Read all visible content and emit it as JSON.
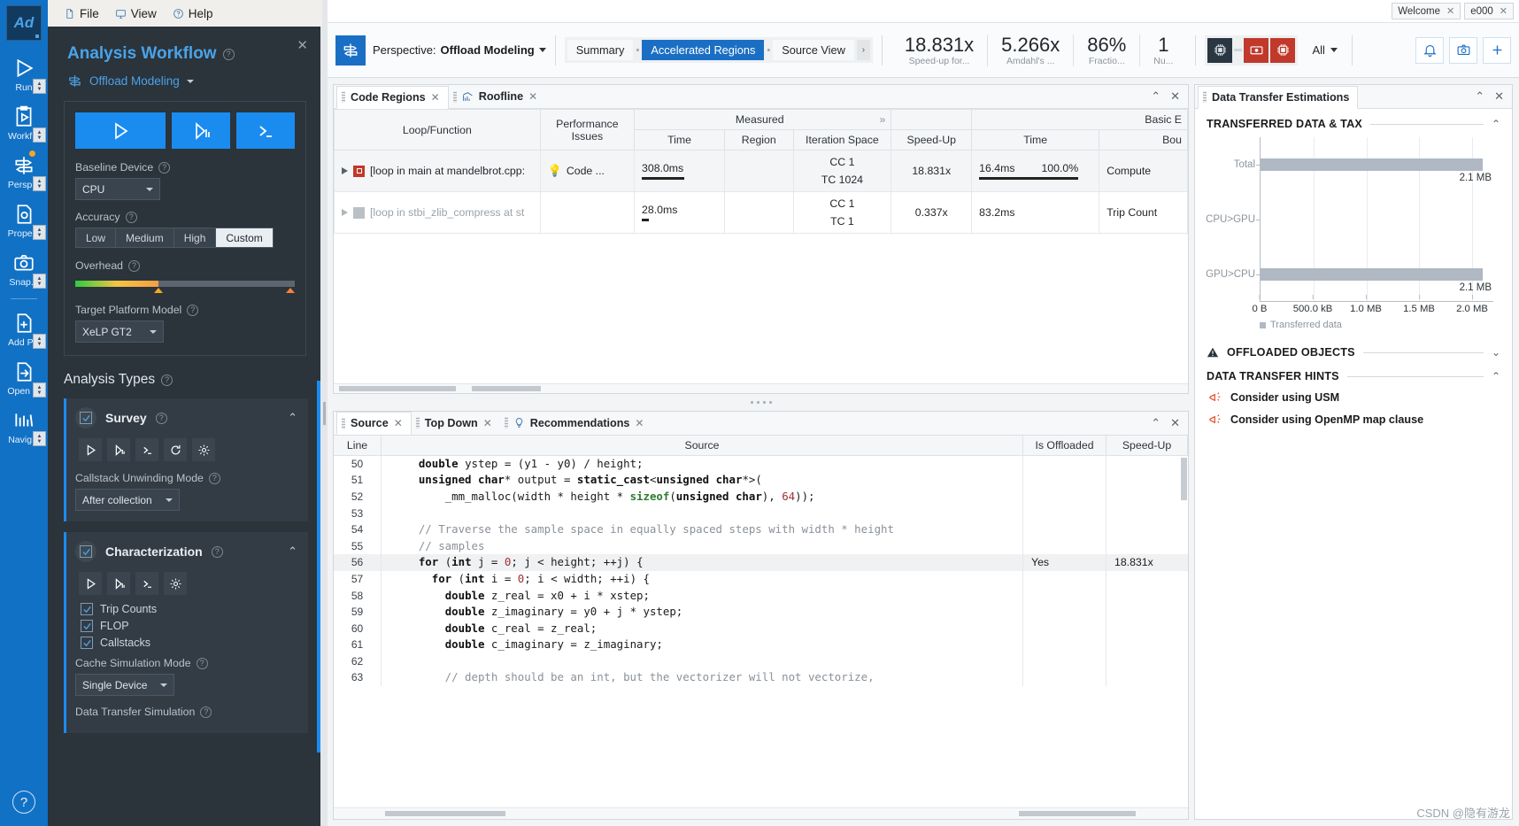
{
  "rail": {
    "logo": "Ad",
    "items": [
      {
        "label": "Run",
        "icon": "play-icon"
      },
      {
        "label": "Workf...",
        "icon": "workflow-icon"
      },
      {
        "label": "Persp...",
        "icon": "perspective-icon"
      },
      {
        "label": "Prope...",
        "icon": "properties-gear-icon"
      },
      {
        "label": "Snap...",
        "icon": "snapshot-camera-icon"
      },
      {
        "label": "Add P...",
        "icon": "add-project-icon"
      },
      {
        "label": "Open ...",
        "icon": "open-result-icon"
      },
      {
        "label": "Navig...",
        "icon": "navigation-chart-icon"
      }
    ],
    "help": "?"
  },
  "menubar": {
    "items": [
      {
        "label": "File",
        "icon": "file-icon"
      },
      {
        "label": "View",
        "icon": "monitor-icon"
      },
      {
        "label": "Help",
        "icon": "help-circle-icon"
      }
    ]
  },
  "titlebar": {
    "tabs": [
      {
        "label": "Welcome",
        "close": "✕"
      },
      {
        "label": "e000",
        "close": "✕"
      }
    ]
  },
  "workflow": {
    "title": "Analysis Workflow",
    "close": "✕",
    "subtitle": "Offload Modeling",
    "baseline_label": "Baseline Device",
    "baseline_value": "CPU",
    "accuracy_label": "Accuracy",
    "accuracy_options": [
      "Low",
      "Medium",
      "High",
      "Custom"
    ],
    "accuracy_selected": "Custom",
    "overhead_label": "Overhead",
    "target_label": "Target Platform Model",
    "target_value": "XeLP GT2",
    "analysis_types_label": "Analysis Types",
    "cards": [
      {
        "title": "Survey",
        "checked": true,
        "sub_label": "Callstack Unwinding Mode",
        "sub_value": "After collection",
        "buttons": [
          "run-icon",
          "run-step-icon",
          "command-line-icon",
          "refresh-icon",
          "gear-icon"
        ],
        "checkboxes": []
      },
      {
        "title": "Characterization",
        "checked": true,
        "sub_label": "Cache Simulation Mode",
        "sub_value": "Single Device",
        "buttons": [
          "run-icon",
          "run-step-icon",
          "command-line-icon",
          "gear-icon"
        ],
        "checkboxes": [
          {
            "label": "Trip Counts",
            "checked": true
          },
          {
            "label": "FLOP",
            "checked": true
          },
          {
            "label": "Callstacks",
            "checked": true
          }
        ],
        "footer_label": "Data Transfer Simulation"
      }
    ]
  },
  "toolbar": {
    "perspective_prefix": "Perspective:",
    "perspective_value": "Offload Modeling",
    "view_tabs": [
      {
        "label": "Summary",
        "active": false
      },
      {
        "label": "Accelerated Regions",
        "active": true
      },
      {
        "label": "Source View",
        "active": false
      }
    ],
    "more_tabs": "›",
    "metrics": [
      {
        "value": "18.831x",
        "caption": "Speed-up for..."
      },
      {
        "value": "5.266x",
        "caption": "Amdahl's ..."
      },
      {
        "value": "86%",
        "caption": "Fractio..."
      },
      {
        "value": "1",
        "caption": "Nu..."
      }
    ],
    "device_filter": "All",
    "devices": [
      "cpu-chip-icon",
      "gpu-icon",
      "gpu-chip-icon"
    ],
    "right_tools": [
      "bell-icon",
      "camera-icon",
      "plus-icon"
    ]
  },
  "code_regions": {
    "tabs": [
      {
        "label": "Code Regions",
        "active": true,
        "icon": null
      },
      {
        "label": "Roofline",
        "active": false,
        "icon": "roofline-icon"
      }
    ],
    "panel_controls": [
      "collapse-icon",
      "close-icon"
    ],
    "group_headers": [
      {
        "label": "Measured",
        "expand": "»"
      },
      {
        "label": "Basic E"
      }
    ],
    "columns": [
      "Loop/Function",
      "Performance Issues",
      "Time",
      "Region",
      "Iteration Space",
      "Speed-Up",
      "Time",
      "Bou"
    ],
    "rows": [
      {
        "name": "[loop in main at mandelbrot.cpp:",
        "marker": "red",
        "issue": "Code ...",
        "time": "308.0ms",
        "time_bar": 72,
        "region": "",
        "iteration_space": [
          "CC 1",
          "TC 1024"
        ],
        "speedup": "18.831x",
        "basic_time": "16.4ms",
        "basic_pct": "100.0%",
        "bounded_by": "Compute",
        "selected": true
      },
      {
        "name": "[loop in stbi_zlib_compress at st",
        "marker": "gray",
        "issue": "",
        "time": "28.0ms",
        "time_bar": 9,
        "region": "",
        "iteration_space": [
          "CC 1",
          "TC 1"
        ],
        "speedup": "0.337x",
        "basic_time": "83.2ms",
        "basic_pct": "",
        "bounded_by": "Trip Count",
        "selected": false
      }
    ]
  },
  "source_panel": {
    "tabs": [
      {
        "label": "Source",
        "active": true,
        "icon": null
      },
      {
        "label": "Top Down",
        "active": false,
        "icon": null
      },
      {
        "label": "Recommendations",
        "active": false,
        "icon": "bulb-icon"
      }
    ],
    "columns": [
      "Line",
      "Source",
      "Is Offloaded",
      "Speed-Up"
    ],
    "lines": [
      {
        "n": "50",
        "code": "    double ystep = (y1 - y0) / height;",
        "offloaded": "",
        "speedup": ""
      },
      {
        "n": "51",
        "code": "    unsigned char* output = static_cast<unsigned char*>(",
        "offloaded": "",
        "speedup": ""
      },
      {
        "n": "52",
        "code": "        _mm_malloc(width * height * sizeof(unsigned char), 64));",
        "offloaded": "",
        "speedup": ""
      },
      {
        "n": "53",
        "code": "",
        "offloaded": "",
        "speedup": ""
      },
      {
        "n": "54",
        "code": "    // Traverse the sample space in equally spaced steps with width * height",
        "offloaded": "",
        "speedup": ""
      },
      {
        "n": "55",
        "code": "    // samples",
        "offloaded": "",
        "speedup": ""
      },
      {
        "n": "56",
        "code": "    for (int j = 0; j < height; ++j) {",
        "offloaded": "Yes",
        "speedup": "18.831x",
        "highlight": true
      },
      {
        "n": "57",
        "code": "      for (int i = 0; i < width; ++i) {",
        "offloaded": "",
        "speedup": ""
      },
      {
        "n": "58",
        "code": "        double z_real = x0 + i * xstep;",
        "offloaded": "",
        "speedup": ""
      },
      {
        "n": "59",
        "code": "        double z_imaginary = y0 + j * ystep;",
        "offloaded": "",
        "speedup": ""
      },
      {
        "n": "60",
        "code": "        double c_real = z_real;",
        "offloaded": "",
        "speedup": ""
      },
      {
        "n": "61",
        "code": "        double c_imaginary = z_imaginary;",
        "offloaded": "",
        "speedup": ""
      },
      {
        "n": "62",
        "code": "",
        "offloaded": "",
        "speedup": ""
      },
      {
        "n": "63",
        "code": "        // depth should be an int, but the vectorizer will not vectorize,",
        "offloaded": "",
        "speedup": ""
      }
    ]
  },
  "data_transfer": {
    "title": "Data Transfer Estimations",
    "panel_controls": [
      "collapse-icon",
      "close-icon"
    ],
    "sections": [
      {
        "title": "TRANSFERRED DATA & TAX",
        "expanded": true,
        "chevron": "⌃"
      },
      {
        "title": "OFFLOADED OBJECTS",
        "expanded": false,
        "chevron": "⌄",
        "icon": "warning-icon"
      },
      {
        "title": "DATA TRANSFER HINTS",
        "expanded": true,
        "chevron": "⌃"
      }
    ],
    "hints": [
      {
        "label": "Consider using USM",
        "icon": "megaphone-icon"
      },
      {
        "label": "Consider using OpenMP map clause",
        "icon": "megaphone-icon"
      }
    ]
  },
  "chart_data": {
    "type": "bar",
    "orientation": "horizontal",
    "title": "TRANSFERRED DATA & TAX",
    "categories": [
      "Total",
      "CPU>GPU",
      "GPU>CPU"
    ],
    "values": [
      2.1,
      0,
      2.1
    ],
    "value_labels": [
      "2.1 MB",
      "",
      "2.1 MB"
    ],
    "unit": "MB",
    "xlabel": "",
    "ylabel": "",
    "xlim": [
      0,
      2.2
    ],
    "xticks": [
      0,
      0.5,
      1.0,
      1.5,
      2.0
    ],
    "xticklabels": [
      "0 B",
      "500.0 kB",
      "1.0 MB",
      "1.5 MB",
      "2.0 MB"
    ],
    "legend": [
      "Transferred data"
    ],
    "legend_position": "bottom-left",
    "grid": true,
    "bar_color": "#b0b8c4"
  },
  "watermark": "CSDN @隐有游龙"
}
